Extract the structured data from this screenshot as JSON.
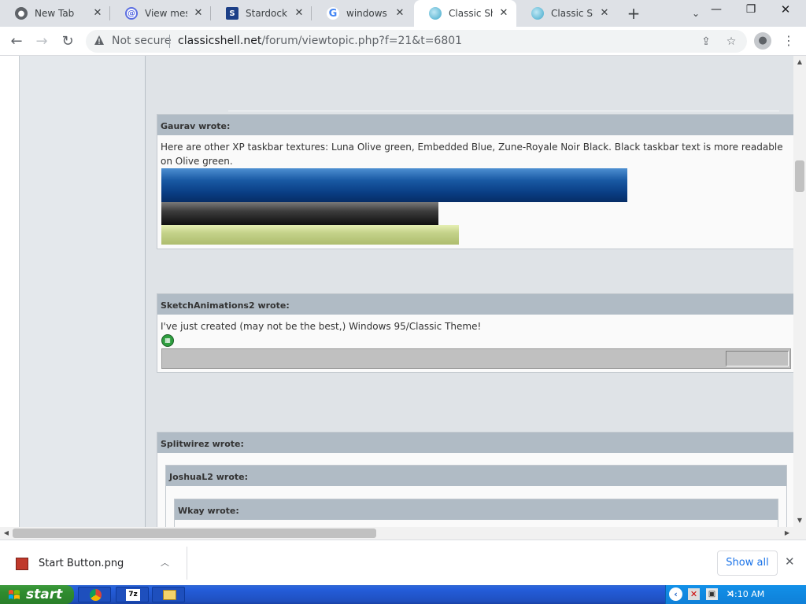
{
  "browser": {
    "tabs": [
      {
        "title": "New Tab",
        "icon": "chrome-icon",
        "active": false
      },
      {
        "title": "View messag",
        "icon": "at-sign-icon",
        "active": false
      },
      {
        "title": "Stardock Ac",
        "icon": "stardock-icon",
        "active": false
      },
      {
        "title": "windows cla",
        "icon": "google-icon",
        "active": false
      },
      {
        "title": "Classic Shell",
        "icon": "classic-shell-icon",
        "active": true
      },
      {
        "title": "Classic Shell",
        "icon": "classic-shell-icon",
        "active": false
      }
    ],
    "new_tab_label": "+",
    "security_label": "Not secure",
    "url_host": "classicshell.net",
    "url_path": "/forum/viewtopic.php?f=21&t=6801"
  },
  "posts": [
    {
      "author": "Gaurav wrote:",
      "text": "Here are other XP taskbar textures: Luna Olive green, Embedded Blue, Zune-Royale Noir Black. Black taskbar text is more readable on Olive green."
    },
    {
      "author": "SketchAnimations2 wrote:",
      "text": "I've just created (may not be the best,) Windows 95/Classic Theme!"
    },
    {
      "author": "Splitwirez wrote:",
      "nested": [
        {
          "author": "JoshuaL2 wrote:"
        },
        {
          "author": "Wkay wrote:"
        }
      ]
    }
  ],
  "download": {
    "filename": "Start Button.png",
    "show_all": "Show all"
  },
  "taskbar": {
    "start_label": "start",
    "clock": "4:10 AM"
  },
  "colors": {
    "quote_header": "#b0bbc5",
    "page_bg": "#dfe3e7",
    "xp_blue": "#245edb",
    "xp_green": "#2e8b2e"
  }
}
